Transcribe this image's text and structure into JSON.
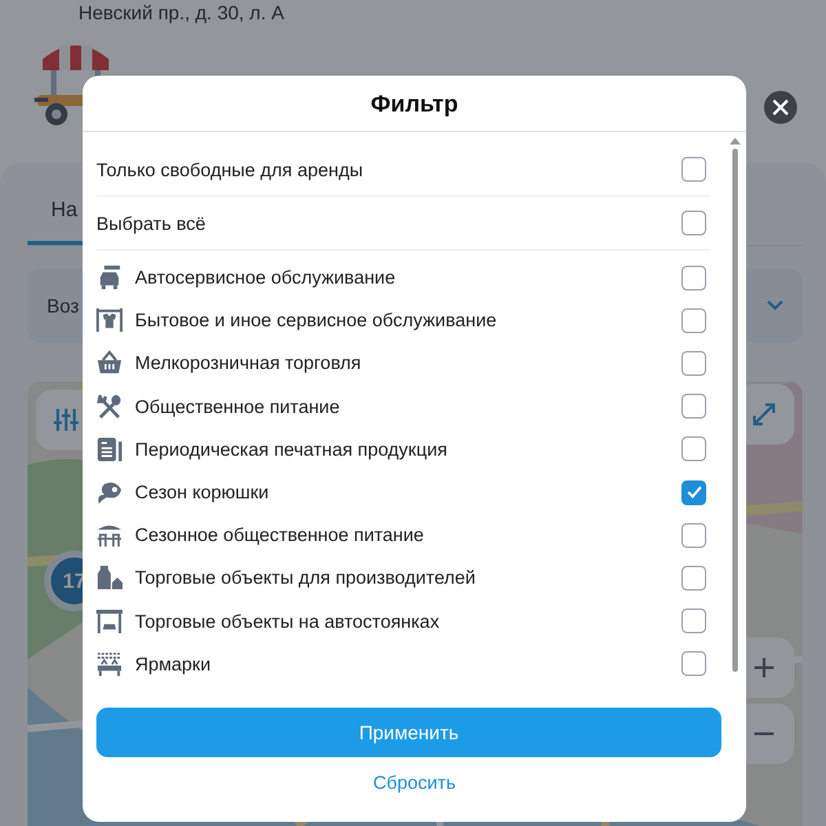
{
  "background": {
    "address": "Невский пр., д. 30, л. А",
    "tab": "На",
    "dropdown": "Воз",
    "cluster_count": "17"
  },
  "dialog": {
    "title": "Фильтр",
    "options": [
      {
        "kind": "toggle",
        "label": "Только свободные для аренды",
        "checked": false
      },
      {
        "kind": "toggle",
        "label": "Выбрать всё",
        "checked": false
      },
      {
        "kind": "category",
        "label": "Автосервисное обслуживание",
        "checked": false
      },
      {
        "kind": "category",
        "label": "Бытовое и иное сервисное обслуживание",
        "checked": false
      },
      {
        "kind": "category",
        "label": "Мелкорозничная торговля",
        "checked": false
      },
      {
        "kind": "category",
        "label": "Общественное питание",
        "checked": false
      },
      {
        "kind": "category",
        "label": "Периодическая печатная продукция",
        "checked": false
      },
      {
        "kind": "category",
        "label": "Сезон корюшки",
        "checked": true
      },
      {
        "kind": "category",
        "label": "Сезонное общественное питание",
        "checked": false
      },
      {
        "kind": "category",
        "label": "Торговые объекты для производителей",
        "checked": false
      },
      {
        "kind": "category",
        "label": "Торговые объекты на автостоянках",
        "checked": false
      },
      {
        "kind": "category",
        "label": "Ярмарки",
        "checked": false
      }
    ],
    "apply_button": "Применить",
    "reset_link": "Сбросить"
  }
}
